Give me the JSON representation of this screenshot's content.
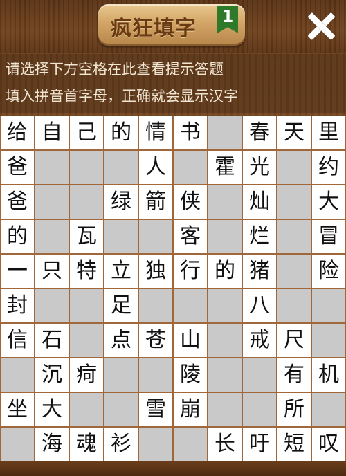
{
  "header": {
    "title": "疯狂填字",
    "level": "1"
  },
  "hints": {
    "line1": "请选择下方空格在此查看提示答题",
    "line2": "填入拼音首字母，正确就会显示汉字"
  },
  "grid": {
    "rows": [
      [
        "给",
        "自",
        "己",
        "的",
        "情",
        "书",
        "",
        "春",
        "天",
        "里"
      ],
      [
        "爸",
        "",
        "",
        "",
        "人",
        "",
        "霍",
        "光",
        "",
        "约"
      ],
      [
        "爸",
        "",
        "",
        "绿",
        "箭",
        "侠",
        "",
        "灿",
        "",
        "大"
      ],
      [
        "的",
        "",
        "瓦",
        "",
        "",
        "客",
        "",
        "烂",
        "",
        "冒"
      ],
      [
        "一",
        "只",
        "特",
        "立",
        "独",
        "行",
        "的",
        "猪",
        "",
        "险"
      ],
      [
        "封",
        "",
        "",
        "足",
        "",
        "",
        "",
        "八",
        "",
        ""
      ],
      [
        "信",
        "石",
        "",
        "点",
        "苍",
        "山",
        "",
        "戒",
        "尺",
        ""
      ],
      [
        "",
        "沉",
        "疴",
        "",
        "",
        "陵",
        "",
        "",
        "有",
        "机"
      ],
      [
        "坐",
        "大",
        "",
        "",
        "雪",
        "崩",
        "",
        "",
        "所",
        ""
      ],
      [
        "",
        "海",
        "魂",
        "衫",
        "",
        "",
        "长",
        "吁",
        "短",
        "叹"
      ]
    ]
  }
}
